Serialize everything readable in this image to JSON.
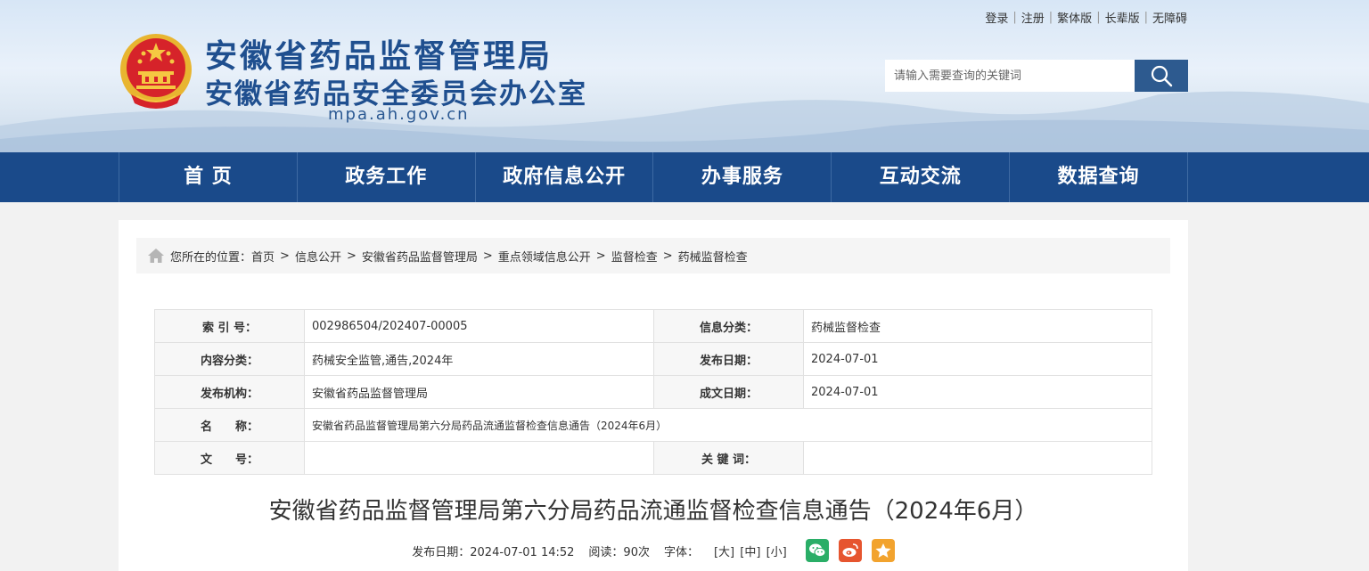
{
  "toplinks": [
    "登录",
    "注册",
    "繁体版",
    "长辈版",
    "无障碍"
  ],
  "site": {
    "title": "安徽省药品监督管理局",
    "subtitle": "安徽省药品安全委员会办公室",
    "domain": "mpa.ah.gov.cn"
  },
  "search": {
    "placeholder": "请输入需要查询的关键词"
  },
  "nav": [
    "首 页",
    "政务工作",
    "政府信息公开",
    "办事服务",
    "互动交流",
    "数据查询"
  ],
  "breadcrumb": {
    "prefix": "您所在的位置：",
    "items": [
      "首页",
      "信息公开",
      "安徽省药品监督管理局",
      "重点领域信息公开",
      "监督检查",
      "药械监督检查"
    ]
  },
  "meta": {
    "index_label": "索 引 号：",
    "index_value": "002986504/202407-00005",
    "category_label": "信息分类：",
    "category_value": "药械监督检查",
    "content_label": "内容分类：",
    "content_value": "药械安全监管,通告,2024年",
    "pubdate_label": "发布日期：",
    "pubdate_value": "2024-07-01",
    "org_label": "发布机构：",
    "org_value": "安徽省药品监督管理局",
    "created_label": "成文日期：",
    "created_value": "2024-07-01",
    "name_label": "名　　称：",
    "name_value": "安徽省药品监督管理局第六分局药品流通监督检查信息通告（2024年6月）",
    "docno_label": "文　　号：",
    "docno_value": "",
    "keyword_label": "关 键 词：",
    "keyword_value": ""
  },
  "article": {
    "title": "安徽省药品监督管理局第六分局药品流通监督检查信息通告（2024年6月）",
    "date_text": "发布日期：2024-07-01 14:52",
    "views_text": "阅读：90次",
    "font_label": "字体：",
    "font_large": "[大]",
    "font_medium": "[中]",
    "font_small": "[小]"
  },
  "colors": {
    "nav_bg": "#1a4a8a",
    "title_blue": "#1f4f8f",
    "wechat": "#2aae67",
    "weibo": "#e6552f",
    "favorite": "#f2a32e"
  }
}
